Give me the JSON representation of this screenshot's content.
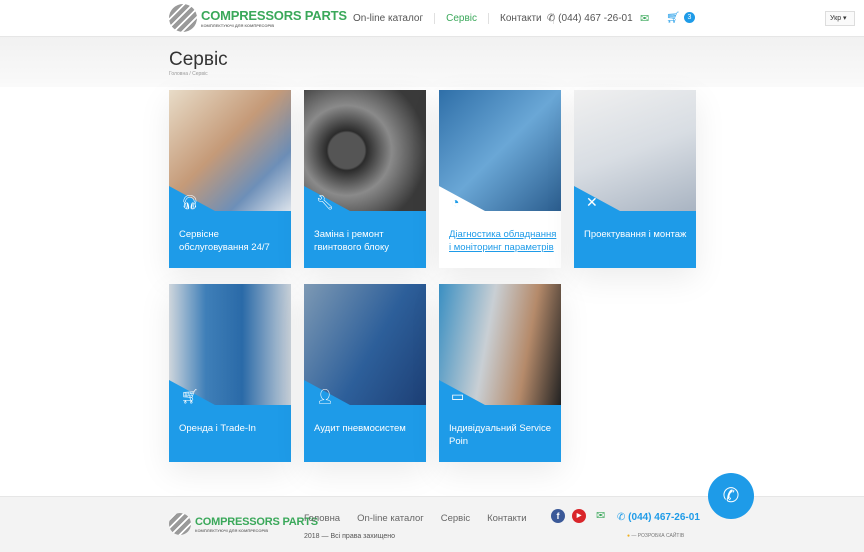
{
  "header": {
    "logo_title": "COMPRESSORS PARTS",
    "logo_sub": "КОМПЛЕКТУЮЧІ ДЛЯ КОМПРЕСОРІВ",
    "nav": [
      "On-line каталог",
      "Сервіс",
      "Контакти"
    ],
    "active_nav": "Сервіс",
    "phone": "(044) 467 -26-01",
    "cart_count": "3",
    "lang": "Укр ▾"
  },
  "page": {
    "title": "Сервіс",
    "breadcrumb": "Головна / Сервіс"
  },
  "cards": [
    {
      "label": "Сервісне обслуговування 24/7",
      "icon": "headset-icon"
    },
    {
      "label": "Заміна і ремонт гвинтового блоку",
      "icon": "wrench-icon"
    },
    {
      "label": "Діагностика обладнання і моніторинг параметрів",
      "icon": "gauge-icon"
    },
    {
      "label": "Проектування і монтаж",
      "icon": "tools-icon"
    },
    {
      "label": "Оренда і Trade-In",
      "icon": "cart-icon"
    },
    {
      "label": "Аудит пневмосистем",
      "icon": "engineer-icon"
    },
    {
      "label": "Індивідуальний Service Poin",
      "icon": "monitor-icon"
    }
  ],
  "footer": {
    "nav": [
      "Головна",
      "On-line каталог",
      "Сервіс",
      "Контакти"
    ],
    "copyright": "2018 — Всі права захищено",
    "phone": "(044) 467-26-01",
    "developer": "— РОЗРОБКА САЙТІВ"
  },
  "colors": {
    "accent": "#1e9be8",
    "brand_green": "#3aa85a"
  }
}
